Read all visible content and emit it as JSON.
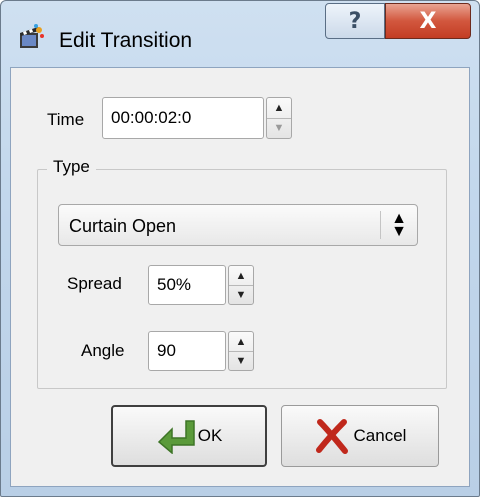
{
  "window": {
    "title": "Edit Transition"
  },
  "titlebar_buttons": {
    "help_label": "?",
    "close_label": "X"
  },
  "time": {
    "label": "Time",
    "value": "00:00:02:0"
  },
  "type_group": {
    "title": "Type",
    "selected": "Curtain Open",
    "spread": {
      "label": "Spread",
      "value": "50%"
    },
    "angle": {
      "label": "Angle",
      "value": "90"
    }
  },
  "buttons": {
    "ok": "OK",
    "cancel": "Cancel"
  },
  "icons": {
    "app": "film-clapper-icon",
    "ok": "green-arrow-icon",
    "cancel": "red-x-icon"
  },
  "colors": {
    "close_button": "#c33d24",
    "ok_arrow": "#5a9a3a",
    "cancel_x": "#c0281c"
  }
}
